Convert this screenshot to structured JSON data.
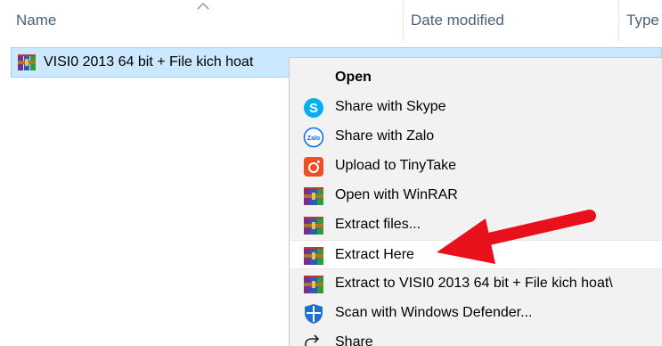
{
  "header": {
    "columns": [
      "Name",
      "Date modified",
      "Type"
    ]
  },
  "file": {
    "name": "VISI0 2013 64 bit + File kich hoat",
    "icon": "winrar-archive-icon"
  },
  "menu": {
    "items": [
      {
        "label": "Open",
        "icon": "none",
        "bold": true
      },
      {
        "label": "Share with Skype",
        "icon": "skype-icon"
      },
      {
        "label": "Share with Zalo",
        "icon": "zalo-icon"
      },
      {
        "label": "Upload to TinyTake",
        "icon": "tinytake-icon"
      },
      {
        "label": "Open with WinRAR",
        "icon": "winrar-icon"
      },
      {
        "label": "Extract files...",
        "icon": "winrar-icon"
      },
      {
        "label": "Extract Here",
        "icon": "winrar-icon",
        "highlighted": true
      },
      {
        "label": "Extract to VISI0 2013 64 bit + File kich hoat\\",
        "icon": "winrar-icon"
      },
      {
        "label": "Scan with Windows Defender...",
        "icon": "windows-defender-icon"
      },
      {
        "label": "Share",
        "icon": "share-icon"
      }
    ]
  },
  "annotation": {
    "arrow_color": "#e8101a"
  },
  "colors": {
    "selection_bg": "#cce8ff",
    "selection_border": "#99d1ff",
    "menu_bg": "#f2f2f2",
    "header_text": "#4c607a"
  }
}
